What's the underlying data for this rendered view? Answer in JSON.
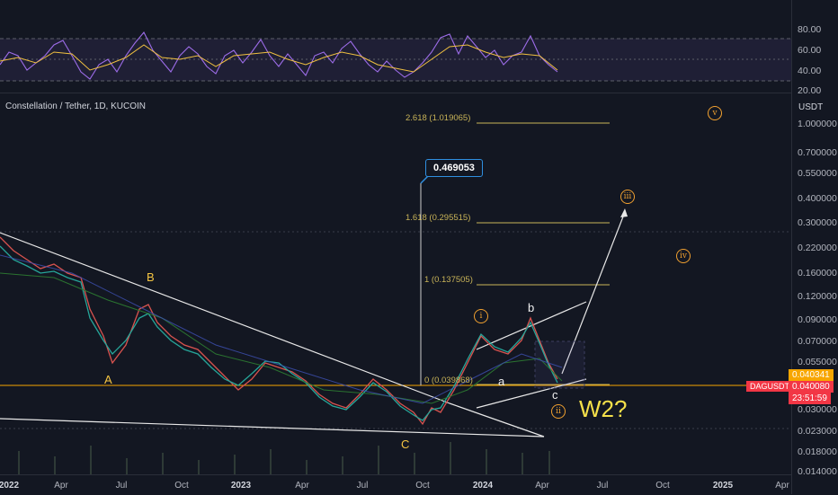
{
  "chart": {
    "title": "Constellation / Tether, 1D, KUCOIN",
    "unit": "USDT",
    "target_price": "0.469053",
    "symbol_tag": "DAGUSDT",
    "price_tag_1": "0.040341",
    "price_tag_2": "0.040080",
    "countdown": "23:51:59",
    "annotation_w2": "W2?"
  },
  "rsi_axis": [
    "80.00",
    "60.00",
    "40.00",
    "20.00"
  ],
  "price_axis": [
    "1.000000",
    "0.700000",
    "0.550000",
    "0.400000",
    "0.300000",
    "0.220000",
    "0.160000",
    "0.120000",
    "0.090000",
    "0.070000",
    "0.055000",
    "0.030000",
    "0.023000",
    "0.018000",
    "0.014000"
  ],
  "time_axis": [
    "2022",
    "Apr",
    "Jul",
    "Oct",
    "2023",
    "Apr",
    "Jul",
    "Oct",
    "2024",
    "Apr",
    "Jul",
    "Oct",
    "2025",
    "Apr"
  ],
  "fib_levels": [
    "2.618 (1.019065)",
    "1.618 (0.295515)",
    "1 (0.137505)",
    "0 (0.039868)"
  ],
  "waves": {
    "A": "A",
    "B": "B",
    "C": "C",
    "a": "a",
    "b": "b",
    "c": "c",
    "i": "i",
    "ii": "ii",
    "iii": "iii",
    "iv": "iv",
    "v": "v"
  },
  "colors": {
    "background": "#131722",
    "fib": "#c9b458",
    "wave_label": "#f5c542",
    "circle": "#f0a030",
    "target_border": "#2f8fe0",
    "symbol_tag": "#f23645",
    "price_tag": "#f7a600"
  }
}
